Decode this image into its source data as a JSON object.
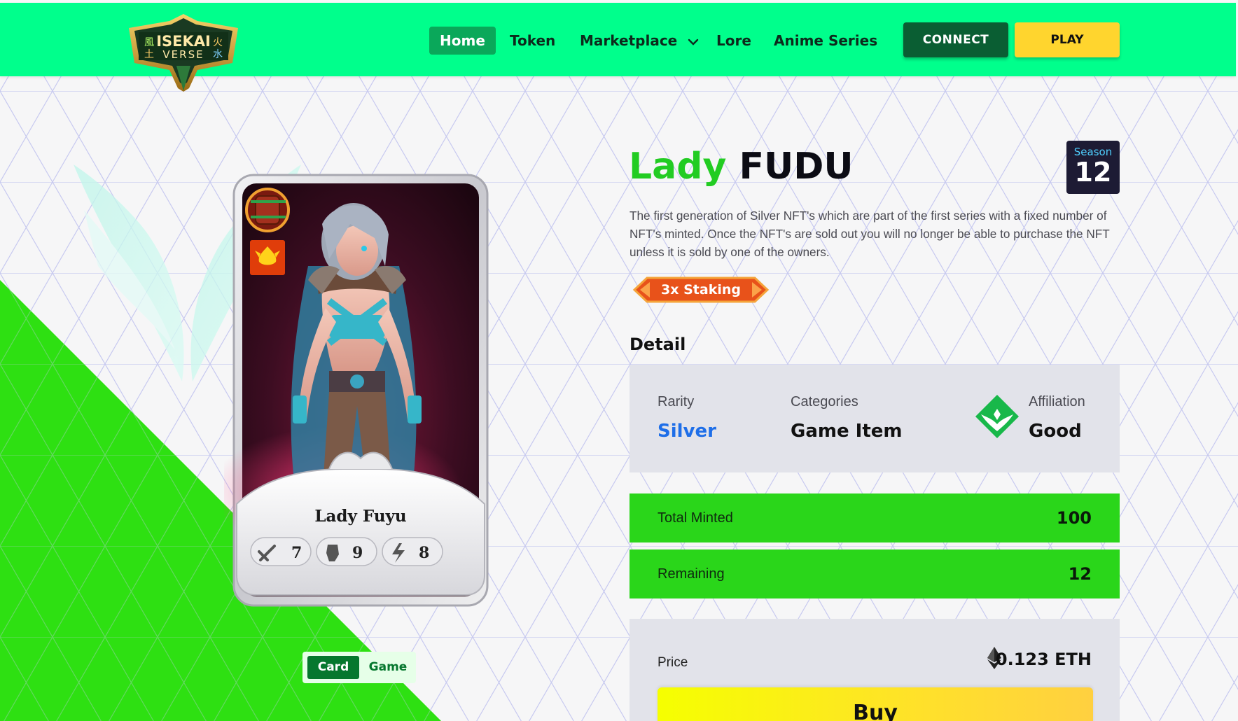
{
  "colors": {
    "header_bg": "#00ff8c",
    "nav_active_bg": "#0aa85a",
    "connect_bg": "#0a5e33",
    "play_bg": "#ffd52e",
    "accent_green": "#22cc22",
    "stat_bar_bg": "#2ad61a",
    "rarity_blue": "#1e6ee8",
    "season_bg": "#1d1b34",
    "bg_triangle_green": "#2ee012"
  },
  "header": {
    "logo": {
      "line1": "ISEKAI",
      "line2": "VERSE",
      "kanji": [
        "風",
        "火",
        "土",
        "水"
      ]
    },
    "nav": [
      {
        "label": "Home",
        "active": true
      },
      {
        "label": "Token",
        "active": false
      },
      {
        "label": "Marketplace",
        "active": false,
        "dropdown": true
      },
      {
        "label": "Lore",
        "active": false
      },
      {
        "label": "Anime Series",
        "active": false
      }
    ],
    "connect_label": "CONNECT",
    "play_label": "PLAY"
  },
  "card": {
    "name": "Lady Fuyu",
    "stats": [
      {
        "icon": "sword-icon",
        "value": "7"
      },
      {
        "icon": "fist-icon",
        "value": "9"
      },
      {
        "icon": "lightning-icon",
        "value": "8"
      }
    ],
    "element_icon": "phoenix-icon",
    "weapon_icon": "barrel-weapon-icon"
  },
  "view_toggle": {
    "card_label": "Card",
    "game_label": "Game",
    "active": "Card"
  },
  "nft": {
    "title_first": "Lady",
    "title_second": "FUDU",
    "season_label": "Season",
    "season_number": "12",
    "description": "The first generation of Silver NFT's which are part of the first series with a fixed number of NFT's minted. Once the NFT's are sold out you will no longer be able to purchase the NFT unless it is sold by one of the owners.",
    "staking_badge": "3x Staking",
    "detail_heading": "Detail",
    "details": {
      "rarity_label": "Rarity",
      "rarity_value": "Silver",
      "categories_label": "Categories",
      "categories_value": "Game Item",
      "affiliation_label": "Affiliation",
      "affiliation_value": "Good",
      "affiliation_icon": "good-wings-icon"
    },
    "total_minted_label": "Total Minted",
    "total_minted_value": "100",
    "remaining_label": "Remaining",
    "remaining_value": "12",
    "price_label": "Price",
    "price_value": "0.123 ETH",
    "price_icon": "ethereum-icon",
    "buy_label": "Buy"
  }
}
